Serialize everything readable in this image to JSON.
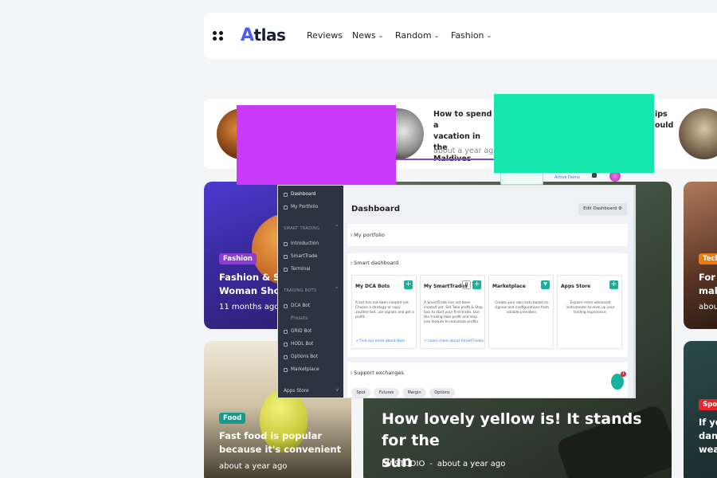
{
  "header": {
    "logo_mark": "A",
    "logo_text": "tlas",
    "nav": [
      {
        "label": "Reviews",
        "has_dropdown": false
      },
      {
        "label": "News",
        "has_dropdown": true
      },
      {
        "label": "Random",
        "has_dropdown": true
      },
      {
        "label": "Fashion",
        "has_dropdown": true
      }
    ],
    "chevron": "⌄"
  },
  "strip": {
    "post_title": "How to spend a vacation in the Maldives",
    "post_title_lines": [
      "How to spend a",
      "vacation in the",
      "Maldives"
    ],
    "post_date": "about a year ago",
    "right_fragments": [
      "ips",
      "ould"
    ]
  },
  "cards": {
    "fashion": {
      "tag": "Fashion",
      "title_lines": [
        "Fashion & Sty",
        "Woman Shou"
      ],
      "date": "11 months ago",
      "tag_color": "#8e3bd6"
    },
    "tech": {
      "tag": "Tech",
      "title_lines": [
        "For g",
        "mak"
      ],
      "date": "abou",
      "tag_color": "#f07a0c"
    },
    "food": {
      "tag": "Food",
      "title_lines": [
        "Fast food is popular",
        "because it's convenient"
      ],
      "date": "about a year ago",
      "tag_color": "#159b8d"
    },
    "featured": {
      "title_lines": [
        "How lovely yellow is! It stands for the",
        "sun"
      ],
      "author": "IW STUDIO",
      "separator": "-",
      "date": "about a year ago"
    },
    "sport": {
      "tag": "Spor",
      "title_lines": [
        "If yo",
        "danc",
        "wea"
      ],
      "tag_color": "#e5262a"
    }
  },
  "dashboard": {
    "sidebar": {
      "items_top": [
        "Dashboard",
        "My Portfolio"
      ],
      "section_smart": "SMART TRADING",
      "items_smart": [
        "Introduction",
        "SmartTrade",
        "Terminal"
      ],
      "section_bots": "TRADING BOTS",
      "items_bots": [
        "DCA Bot",
        "Presets",
        "GRID Bot",
        "HODL Bot",
        "Options Bot",
        "Marketplace"
      ],
      "apps_store": "Apps Store"
    },
    "title": "Dashboard",
    "edit_button": "Edit Dashboard",
    "my_portfolio": "My portfolio",
    "smart_dashboard": "Smart dashboard",
    "tiles": [
      {
        "title": "My DCA Bots",
        "text": "A bot has not been created yet. Choose a strategy or copy another bot, use signals and get a profit.",
        "link": "Find out more about Bots"
      },
      {
        "title": "My SmartTrades",
        "badge": "0",
        "text": "A SmartTrade has not been created yet. Set Take profit & Stop loss to start your first trade. Use the trailing take profit and stop loss feature to maximize profits.",
        "link": "Learn more about SmartTrades"
      },
      {
        "title": "Marketplace",
        "text": "Create your own bots based on signals and configurations from reliable providers."
      },
      {
        "title": "Apps Store",
        "text": "Explore more advanced instruments to level up your trading experience."
      }
    ],
    "support_exchanges": "Support exchanges",
    "pills": [
      "Spot",
      "Futures",
      "Margin",
      "Options"
    ],
    "chat_badge": "1",
    "top_right_text": "Active Demo"
  },
  "colors": {
    "accent": "#4c5cf6",
    "overlay_magenta": "#c93af8",
    "overlay_teal": "#15e6ad",
    "dash_green": "#16b39a"
  }
}
